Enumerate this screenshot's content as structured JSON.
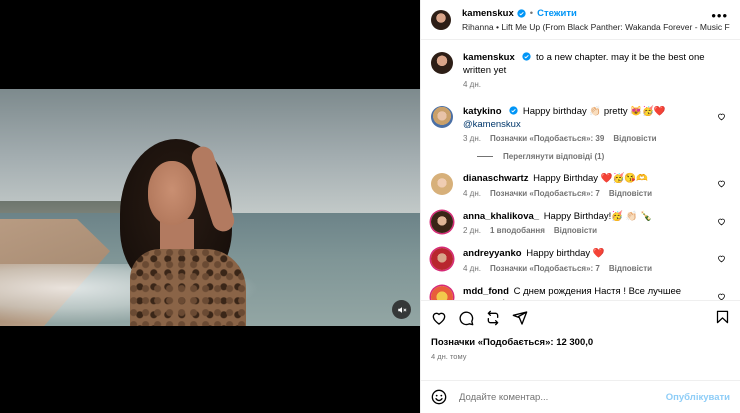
{
  "post": {
    "author": "kamenskux",
    "follow_label": "Стежити",
    "separator": "•",
    "music": "Rihanna • Lift Me Up (From Black Panther: Wakanda Forever - Music From",
    "more_label": "•••"
  },
  "caption": {
    "username": "kamenskux",
    "text": "to a new chapter. may it be the best one written yet",
    "time": "4 дн."
  },
  "comments": [
    {
      "username": "katykino",
      "verified": true,
      "text": "Happy birthday 👏🏻 pretty 😻🥳❤️",
      "mention": "@kamenskux",
      "time": "3 дн.",
      "likes": "Позначки «Подобається»: 39",
      "reply": "Відповісти",
      "view_replies": "Переглянути відповіді (1)"
    },
    {
      "username": "dianaschwartz",
      "text": "Happy Birthday ❤️🥳😘🫶",
      "time": "4 дн.",
      "likes": "Позначки «Подобається»: 7",
      "reply": "Відповісти"
    },
    {
      "username": "anna_khalikova_",
      "text": "Happy Birthday!🥳 👏🏻 🍾",
      "time": "2 дн.",
      "likes": "1 вподобання",
      "reply": "Відповісти"
    },
    {
      "username": "andreyyanko",
      "text": "Happy birthday ❤️",
      "time": "4 дн.",
      "likes": "Позначки «Подобається»: 7",
      "reply": "Відповісти"
    },
    {
      "username": "mdd_fond",
      "text": "С днем рождения Настя ! Все лучшее впереди !"
    }
  ],
  "footer": {
    "likes": "Позначки «Подобається»: 12 300,0",
    "time": "4 дн. тому"
  },
  "composer": {
    "placeholder": "Додайте коментар...",
    "publish_label": "Опублікувати"
  },
  "colors": {
    "accent": "#0095f6",
    "publish_disabled": "#8ecdf7",
    "muted_text": "#737373",
    "like_red": "#ff3040"
  }
}
